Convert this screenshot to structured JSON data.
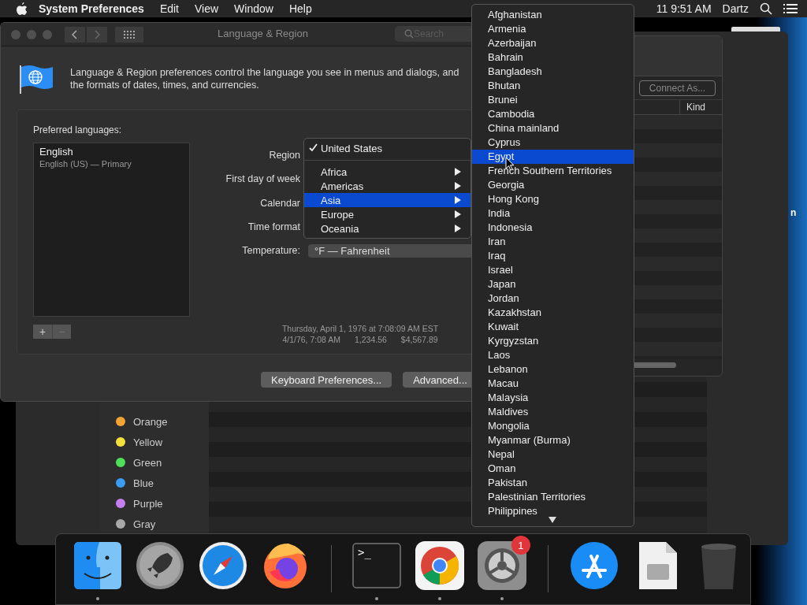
{
  "menubar": {
    "app": "System Preferences",
    "menus": [
      "Edit",
      "View",
      "Window",
      "Help"
    ],
    "clock": "11 9:51 AM",
    "user": "Dartz"
  },
  "desktop_label": "n",
  "finder_window": {
    "tags": [
      {
        "name": "Orange",
        "color": "#f4a434"
      },
      {
        "name": "Yellow",
        "color": "#f6df3a"
      },
      {
        "name": "Green",
        "color": "#4fe05a"
      },
      {
        "name": "Blue",
        "color": "#3a9cf3"
      },
      {
        "name": "Purple",
        "color": "#c47ef0"
      },
      {
        "name": "Gray",
        "color": "#a8a8a8"
      }
    ]
  },
  "connect_window": {
    "button": "Connect As...",
    "column": "Kind"
  },
  "prefs_window": {
    "title": "Language & Region",
    "search": {
      "placeholder": "Search"
    },
    "description": "Language & Region preferences control the language you see in menus and dialogs, and the formats of dates, times, and currencies.",
    "languages_label": "Preferred languages:",
    "languages": [
      {
        "name": "English",
        "detail": "English (US) — Primary"
      }
    ],
    "list_buttons": [
      "+",
      "−"
    ],
    "fields": [
      {
        "label": "Region"
      },
      {
        "label": "First day of week"
      },
      {
        "label": "Calendar"
      },
      {
        "label": "Time format"
      },
      {
        "label": "Temperature:",
        "value": "°F — Fahrenheit"
      }
    ],
    "sample_long": "Thursday, April 1, 1976 at 7:08:09 AM EST",
    "sample_short": [
      "4/1/76, 7:08 AM",
      "1,234.56",
      "$4,567.89"
    ],
    "buttons": [
      "Keyboard Preferences...",
      "Advanced..."
    ]
  },
  "region_menu": {
    "items": [
      {
        "kind": "item",
        "label": "United States",
        "checked": true
      },
      {
        "kind": "separator"
      },
      {
        "kind": "submenu",
        "label": "Africa",
        "selected": false
      },
      {
        "kind": "submenu",
        "label": "Americas",
        "selected": false
      },
      {
        "kind": "submenu",
        "label": "Asia",
        "selected": true
      },
      {
        "kind": "submenu",
        "label": "Europe",
        "selected": false
      },
      {
        "kind": "submenu",
        "label": "Oceania",
        "selected": false
      }
    ]
  },
  "country_menu": {
    "items": [
      {
        "label": "Afghanistan",
        "selected": false
      },
      {
        "label": "Armenia",
        "selected": false
      },
      {
        "label": "Azerbaijan",
        "selected": false
      },
      {
        "label": "Bahrain",
        "selected": false
      },
      {
        "label": "Bangladesh",
        "selected": false
      },
      {
        "label": "Bhutan",
        "selected": false
      },
      {
        "label": "Brunei",
        "selected": false
      },
      {
        "label": "Cambodia",
        "selected": false
      },
      {
        "label": "China mainland",
        "selected": false
      },
      {
        "label": "Cyprus",
        "selected": false
      },
      {
        "label": "Egypt",
        "selected": true
      },
      {
        "label": "French Southern Territories",
        "selected": false
      },
      {
        "label": "Georgia",
        "selected": false
      },
      {
        "label": "Hong Kong",
        "selected": false
      },
      {
        "label": "India",
        "selected": false
      },
      {
        "label": "Indonesia",
        "selected": false
      },
      {
        "label": "Iran",
        "selected": false
      },
      {
        "label": "Iraq",
        "selected": false
      },
      {
        "label": "Israel",
        "selected": false
      },
      {
        "label": "Japan",
        "selected": false
      },
      {
        "label": "Jordan",
        "selected": false
      },
      {
        "label": "Kazakhstan",
        "selected": false
      },
      {
        "label": "Kuwait",
        "selected": false
      },
      {
        "label": "Kyrgyzstan",
        "selected": false
      },
      {
        "label": "Laos",
        "selected": false
      },
      {
        "label": "Lebanon",
        "selected": false
      },
      {
        "label": "Macau",
        "selected": false
      },
      {
        "label": "Malaysia",
        "selected": false
      },
      {
        "label": "Maldives",
        "selected": false
      },
      {
        "label": "Mongolia",
        "selected": false
      },
      {
        "label": "Myanmar (Burma)",
        "selected": false
      },
      {
        "label": "Nepal",
        "selected": false
      },
      {
        "label": "Oman",
        "selected": false
      },
      {
        "label": "Pakistan",
        "selected": false
      },
      {
        "label": "Palestinian Territories",
        "selected": false
      },
      {
        "label": "Philippines",
        "selected": false
      }
    ]
  },
  "dock": {
    "items": [
      {
        "kind": "finder",
        "running": true
      },
      {
        "kind": "launchpad",
        "running": false
      },
      {
        "kind": "safari",
        "running": false
      },
      {
        "kind": "firefox",
        "running": false
      },
      {
        "kind": "separator"
      },
      {
        "kind": "terminal",
        "running": true,
        "label": ">_"
      },
      {
        "kind": "chrome",
        "running": true
      },
      {
        "kind": "settings",
        "running": true,
        "badge": "1"
      },
      {
        "kind": "separator"
      },
      {
        "kind": "appstore",
        "running": false
      },
      {
        "kind": "document",
        "running": false
      },
      {
        "kind": "trash",
        "running": false
      }
    ]
  }
}
